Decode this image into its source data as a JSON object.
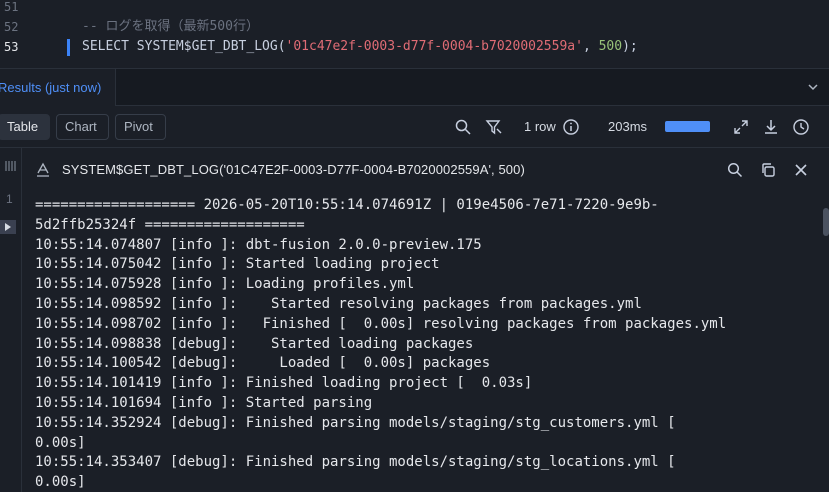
{
  "editor": {
    "lines": [
      {
        "num": "51",
        "comment": ""
      },
      {
        "num": "52",
        "comment": "-- ログを取得（最新500行）"
      },
      {
        "num": "53",
        "kw1": "SELECT",
        "fn": "SYSTEM$GET_DBT_LOG",
        "open": "(",
        "str": "'01c47e2f-0003-d77f-0004-b7020002559a'",
        "comma": ", ",
        "num_arg": "500",
        "close": ");"
      }
    ]
  },
  "results": {
    "tab_label": "Results (just now)"
  },
  "toolbar": {
    "table_label": "Table",
    "chart_label": "Chart",
    "pivot_label": "Pivot",
    "row_count": "1 row",
    "duration": "203ms",
    "progress_fraction": 1.0
  },
  "grid": {
    "row_number": "1"
  },
  "panel": {
    "title": "SYSTEM$GET_DBT_LOG('01C47E2F-0003-D77F-0004-B7020002559A', 500)",
    "log_lines": [
      "=================== 2026-05-20T10:55:14.074691Z | 019e4506-7e71-7220-9e9b-",
      "5d2ffb25324f ===================",
      "10:55:14.074807 [info ]: dbt-fusion 2.0.0-preview.175",
      "10:55:14.075042 [info ]: Started loading project",
      "10:55:14.075928 [info ]: Loading profiles.yml",
      "10:55:14.098592 [info ]:    Started resolving packages from packages.yml",
      "10:55:14.098702 [info ]:   Finished [  0.00s] resolving packages from packages.yml",
      "10:55:14.098838 [debug]:    Started loading packages",
      "10:55:14.100542 [debug]:     Loaded [  0.00s] packages",
      "10:55:14.101419 [info ]: Finished loading project [  0.03s]",
      "10:55:14.101694 [info ]: Started parsing",
      "10:55:14.352924 [debug]: Finished parsing models/staging/stg_customers.yml [",
      "0.00s]",
      "10:55:14.353407 [debug]: Finished parsing models/staging/stg_locations.yml [",
      "0.00s]"
    ]
  },
  "colors": {
    "accent": "#4f8ff7",
    "background": "#1b1f27",
    "string": "#e06c75",
    "number": "#98c379",
    "comment": "#6b7280"
  }
}
